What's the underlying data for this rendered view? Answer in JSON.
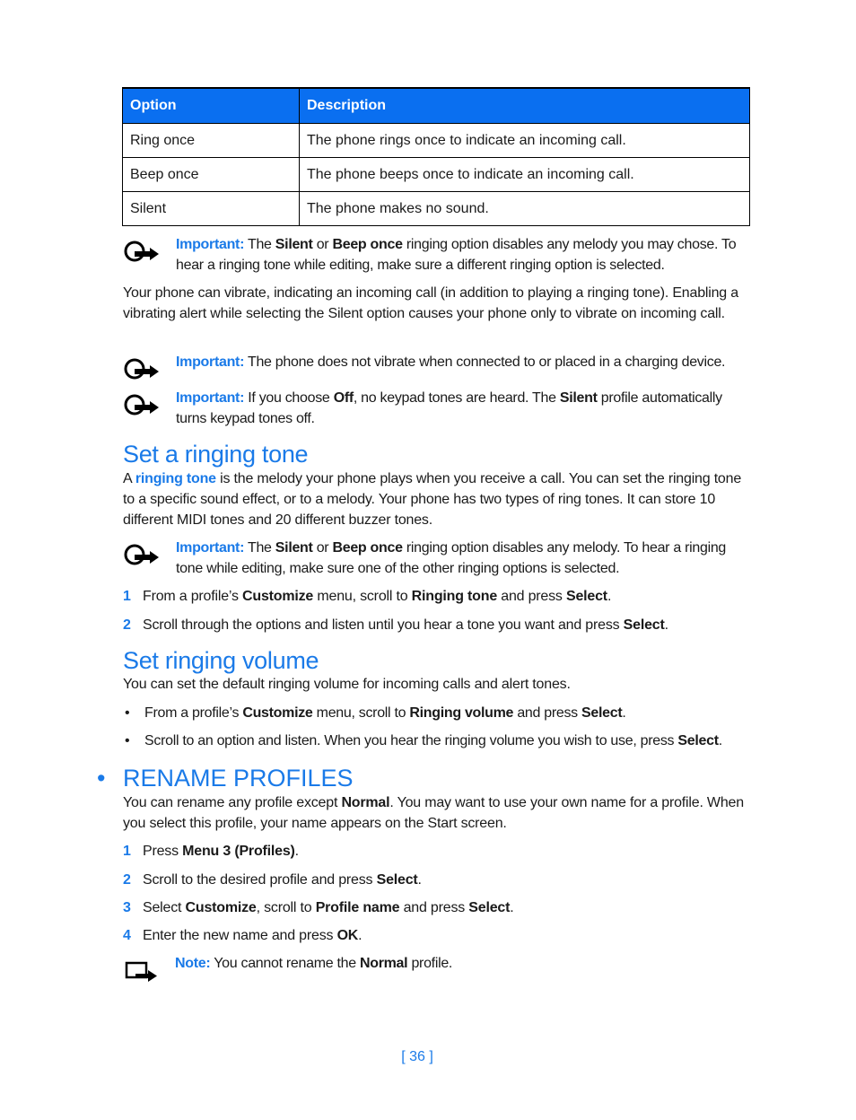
{
  "table": {
    "headers": [
      "Option",
      "Description"
    ],
    "rows": [
      [
        "Ring once",
        "The phone rings once to indicate an incoming call."
      ],
      [
        "Beep once",
        "The phone beeps once to indicate an incoming call."
      ],
      [
        "Silent",
        "The phone makes no sound."
      ]
    ]
  },
  "notes": {
    "important_label": "Important:",
    "note_label": "Note:",
    "n1": {
      "p1": " The ",
      "b1": "Silent",
      "p2": " or ",
      "b2": "Beep once",
      "p3": " ringing option disables any melody you may chose. To hear a ringing tone while editing, make sure a different ringing option is selected."
    },
    "vibrate_para": "Your phone can vibrate, indicating an incoming call (in addition to playing a ringing tone). Enabling a vibrating alert while selecting the Silent option causes your phone only to vibrate on incoming call.",
    "n2": {
      "p1": " The phone does not vibrate when connected to or placed in a charging device."
    },
    "n3": {
      "p1": " If you choose ",
      "b1": "Off",
      "p2": ", no keypad tones are heard. The ",
      "b2": "Silent",
      "p3": " profile automatically turns keypad tones off."
    }
  },
  "set_ringing_tone": {
    "title": "Set a ringing tone",
    "intro_a": "A ",
    "intro_link": "ringing tone",
    "intro_b": " is the melody your phone plays when you receive a call. You can set the ringing tone to a specific sound effect, or to a melody. Your phone has two types of ring tones. It can store 10 different MIDI tones and 20 different buzzer tones.",
    "note": {
      "p1": " The ",
      "b1": "Silent",
      "p2": " or ",
      "b2": "Beep once",
      "p3": " ringing option disables any melody. To hear a ringing tone while editing, make sure one of the other ringing options is selected."
    },
    "steps": [
      {
        "num": "1",
        "a": "From a profile’s ",
        "b1": "Customize",
        "c": " menu, scroll to ",
        "b2": "Ringing tone",
        "d": " and press ",
        "b3": "Select",
        "e": "."
      },
      {
        "num": "2",
        "a": "Scroll through the options and listen until you hear a tone you want and press ",
        "b1": "Select",
        "e": "."
      }
    ]
  },
  "set_ringing_volume": {
    "title": "Set ringing volume",
    "intro": "You can set the default ringing volume for incoming calls and alert tones.",
    "bullets": [
      {
        "a": "From a profile’s ",
        "b1": "Customize",
        "c": " menu, scroll to ",
        "b2": "Ringing volume",
        "d": " and press ",
        "b3": "Select",
        "e": "."
      },
      {
        "a": "Scroll to an option and listen. When you hear the ringing volume you wish to use, press ",
        "b1": "Select",
        "e": "."
      }
    ],
    "bullet_char": "•"
  },
  "rename_profiles": {
    "bullet_char": "•",
    "title": "RENAME PROFILES",
    "intro_a": "You can rename any profile except ",
    "intro_b1": "Normal",
    "intro_c": ". You may want to use your own name for a profile. When you select this profile, your name appears on the Start screen.",
    "steps": [
      {
        "num": "1",
        "a": "Press ",
        "b1": "Menu 3 (Profiles)",
        "e": "."
      },
      {
        "num": "2",
        "a": "Scroll to the desired profile and press ",
        "b1": "Select",
        "e": "."
      },
      {
        "num": "3",
        "a": "Select ",
        "b1": "Customize",
        "c": ", scroll to ",
        "b2": "Profile name",
        "d": " and press ",
        "b3": "Select",
        "e": "."
      },
      {
        "num": "4",
        "a": "Enter the new name and press ",
        "b1": "OK",
        "e": "."
      }
    ],
    "note": {
      "a": " You cannot rename the ",
      "b1": "Normal",
      "c": " profile."
    }
  },
  "footer": {
    "page_number": "[ 36 ]"
  },
  "icons": {
    "important": "important-hand-icon",
    "note": "note-icon"
  },
  "colors": {
    "accent": "#1a7ae8",
    "table_header": "#0a6ff0"
  }
}
